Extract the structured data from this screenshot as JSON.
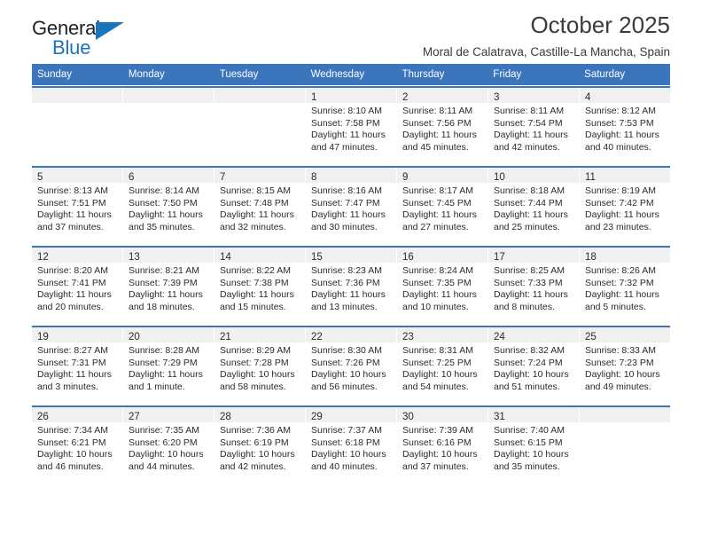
{
  "brand": {
    "name_top": "General",
    "name_bottom": "Blue",
    "accent_color": "#1b75bb"
  },
  "header": {
    "title": "October 2025",
    "subtitle": "Moral de Calatrava, Castille-La Mancha, Spain"
  },
  "calendar": {
    "header_color": "#3b75bc",
    "weekdays": [
      "Sunday",
      "Monday",
      "Tuesday",
      "Wednesday",
      "Thursday",
      "Friday",
      "Saturday"
    ],
    "weeks": [
      [
        {
          "day": "",
          "sunrise": "",
          "sunset": "",
          "daylight_1": "",
          "daylight_2": ""
        },
        {
          "day": "",
          "sunrise": "",
          "sunset": "",
          "daylight_1": "",
          "daylight_2": ""
        },
        {
          "day": "",
          "sunrise": "",
          "sunset": "",
          "daylight_1": "",
          "daylight_2": ""
        },
        {
          "day": "1",
          "sunrise": "Sunrise: 8:10 AM",
          "sunset": "Sunset: 7:58 PM",
          "daylight_1": "Daylight: 11 hours",
          "daylight_2": "and 47 minutes."
        },
        {
          "day": "2",
          "sunrise": "Sunrise: 8:11 AM",
          "sunset": "Sunset: 7:56 PM",
          "daylight_1": "Daylight: 11 hours",
          "daylight_2": "and 45 minutes."
        },
        {
          "day": "3",
          "sunrise": "Sunrise: 8:11 AM",
          "sunset": "Sunset: 7:54 PM",
          "daylight_1": "Daylight: 11 hours",
          "daylight_2": "and 42 minutes."
        },
        {
          "day": "4",
          "sunrise": "Sunrise: 8:12 AM",
          "sunset": "Sunset: 7:53 PM",
          "daylight_1": "Daylight: 11 hours",
          "daylight_2": "and 40 minutes."
        }
      ],
      [
        {
          "day": "5",
          "sunrise": "Sunrise: 8:13 AM",
          "sunset": "Sunset: 7:51 PM",
          "daylight_1": "Daylight: 11 hours",
          "daylight_2": "and 37 minutes."
        },
        {
          "day": "6",
          "sunrise": "Sunrise: 8:14 AM",
          "sunset": "Sunset: 7:50 PM",
          "daylight_1": "Daylight: 11 hours",
          "daylight_2": "and 35 minutes."
        },
        {
          "day": "7",
          "sunrise": "Sunrise: 8:15 AM",
          "sunset": "Sunset: 7:48 PM",
          "daylight_1": "Daylight: 11 hours",
          "daylight_2": "and 32 minutes."
        },
        {
          "day": "8",
          "sunrise": "Sunrise: 8:16 AM",
          "sunset": "Sunset: 7:47 PM",
          "daylight_1": "Daylight: 11 hours",
          "daylight_2": "and 30 minutes."
        },
        {
          "day": "9",
          "sunrise": "Sunrise: 8:17 AM",
          "sunset": "Sunset: 7:45 PM",
          "daylight_1": "Daylight: 11 hours",
          "daylight_2": "and 27 minutes."
        },
        {
          "day": "10",
          "sunrise": "Sunrise: 8:18 AM",
          "sunset": "Sunset: 7:44 PM",
          "daylight_1": "Daylight: 11 hours",
          "daylight_2": "and 25 minutes."
        },
        {
          "day": "11",
          "sunrise": "Sunrise: 8:19 AM",
          "sunset": "Sunset: 7:42 PM",
          "daylight_1": "Daylight: 11 hours",
          "daylight_2": "and 23 minutes."
        }
      ],
      [
        {
          "day": "12",
          "sunrise": "Sunrise: 8:20 AM",
          "sunset": "Sunset: 7:41 PM",
          "daylight_1": "Daylight: 11 hours",
          "daylight_2": "and 20 minutes."
        },
        {
          "day": "13",
          "sunrise": "Sunrise: 8:21 AM",
          "sunset": "Sunset: 7:39 PM",
          "daylight_1": "Daylight: 11 hours",
          "daylight_2": "and 18 minutes."
        },
        {
          "day": "14",
          "sunrise": "Sunrise: 8:22 AM",
          "sunset": "Sunset: 7:38 PM",
          "daylight_1": "Daylight: 11 hours",
          "daylight_2": "and 15 minutes."
        },
        {
          "day": "15",
          "sunrise": "Sunrise: 8:23 AM",
          "sunset": "Sunset: 7:36 PM",
          "daylight_1": "Daylight: 11 hours",
          "daylight_2": "and 13 minutes."
        },
        {
          "day": "16",
          "sunrise": "Sunrise: 8:24 AM",
          "sunset": "Sunset: 7:35 PM",
          "daylight_1": "Daylight: 11 hours",
          "daylight_2": "and 10 minutes."
        },
        {
          "day": "17",
          "sunrise": "Sunrise: 8:25 AM",
          "sunset": "Sunset: 7:33 PM",
          "daylight_1": "Daylight: 11 hours",
          "daylight_2": "and 8 minutes."
        },
        {
          "day": "18",
          "sunrise": "Sunrise: 8:26 AM",
          "sunset": "Sunset: 7:32 PM",
          "daylight_1": "Daylight: 11 hours",
          "daylight_2": "and 5 minutes."
        }
      ],
      [
        {
          "day": "19",
          "sunrise": "Sunrise: 8:27 AM",
          "sunset": "Sunset: 7:31 PM",
          "daylight_1": "Daylight: 11 hours",
          "daylight_2": "and 3 minutes."
        },
        {
          "day": "20",
          "sunrise": "Sunrise: 8:28 AM",
          "sunset": "Sunset: 7:29 PM",
          "daylight_1": "Daylight: 11 hours",
          "daylight_2": "and 1 minute."
        },
        {
          "day": "21",
          "sunrise": "Sunrise: 8:29 AM",
          "sunset": "Sunset: 7:28 PM",
          "daylight_1": "Daylight: 10 hours",
          "daylight_2": "and 58 minutes."
        },
        {
          "day": "22",
          "sunrise": "Sunrise: 8:30 AM",
          "sunset": "Sunset: 7:26 PM",
          "daylight_1": "Daylight: 10 hours",
          "daylight_2": "and 56 minutes."
        },
        {
          "day": "23",
          "sunrise": "Sunrise: 8:31 AM",
          "sunset": "Sunset: 7:25 PM",
          "daylight_1": "Daylight: 10 hours",
          "daylight_2": "and 54 minutes."
        },
        {
          "day": "24",
          "sunrise": "Sunrise: 8:32 AM",
          "sunset": "Sunset: 7:24 PM",
          "daylight_1": "Daylight: 10 hours",
          "daylight_2": "and 51 minutes."
        },
        {
          "day": "25",
          "sunrise": "Sunrise: 8:33 AM",
          "sunset": "Sunset: 7:23 PM",
          "daylight_1": "Daylight: 10 hours",
          "daylight_2": "and 49 minutes."
        }
      ],
      [
        {
          "day": "26",
          "sunrise": "Sunrise: 7:34 AM",
          "sunset": "Sunset: 6:21 PM",
          "daylight_1": "Daylight: 10 hours",
          "daylight_2": "and 46 minutes."
        },
        {
          "day": "27",
          "sunrise": "Sunrise: 7:35 AM",
          "sunset": "Sunset: 6:20 PM",
          "daylight_1": "Daylight: 10 hours",
          "daylight_2": "and 44 minutes."
        },
        {
          "day": "28",
          "sunrise": "Sunrise: 7:36 AM",
          "sunset": "Sunset: 6:19 PM",
          "daylight_1": "Daylight: 10 hours",
          "daylight_2": "and 42 minutes."
        },
        {
          "day": "29",
          "sunrise": "Sunrise: 7:37 AM",
          "sunset": "Sunset: 6:18 PM",
          "daylight_1": "Daylight: 10 hours",
          "daylight_2": "and 40 minutes."
        },
        {
          "day": "30",
          "sunrise": "Sunrise: 7:39 AM",
          "sunset": "Sunset: 6:16 PM",
          "daylight_1": "Daylight: 10 hours",
          "daylight_2": "and 37 minutes."
        },
        {
          "day": "31",
          "sunrise": "Sunrise: 7:40 AM",
          "sunset": "Sunset: 6:15 PM",
          "daylight_1": "Daylight: 10 hours",
          "daylight_2": "and 35 minutes."
        },
        {
          "day": "",
          "sunrise": "",
          "sunset": "",
          "daylight_1": "",
          "daylight_2": ""
        }
      ]
    ]
  }
}
